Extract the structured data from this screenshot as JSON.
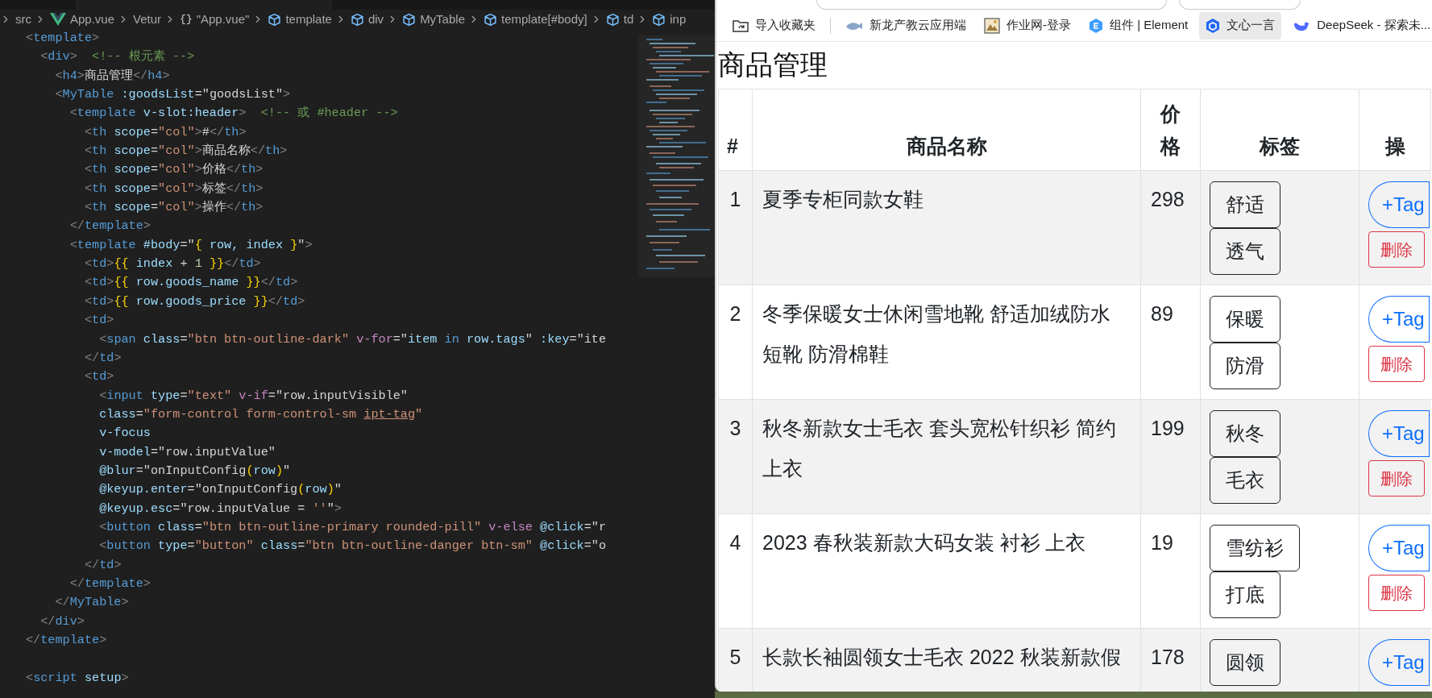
{
  "editor": {
    "breadcrumb": [
      {
        "kind": "folder",
        "text": "src"
      },
      {
        "kind": "vue",
        "text": "App.vue"
      },
      {
        "kind": "folder",
        "text": "Vetur"
      },
      {
        "kind": "module",
        "glyph": "{}",
        "text": "\"App.vue\""
      },
      {
        "kind": "element",
        "text": "template"
      },
      {
        "kind": "element",
        "text": "div"
      },
      {
        "kind": "element",
        "text": "MyTable"
      },
      {
        "kind": "element",
        "text": "template[#body]"
      },
      {
        "kind": "element",
        "text": "td"
      },
      {
        "kind": "element",
        "text": "inp"
      }
    ],
    "code": [
      {
        "tokens": [
          {
            "kind": "p",
            "text": "<"
          },
          {
            "kind": "tg",
            "text": "template"
          },
          {
            "kind": "p",
            "text": ">"
          }
        ]
      },
      {
        "tokens": [
          {
            "kind": "p",
            "text": "  <"
          },
          {
            "kind": "tg",
            "text": "div"
          },
          {
            "kind": "p",
            "text": ">"
          },
          {
            "kind": "c",
            "text": "  <!-- 根元素 -->"
          }
        ]
      },
      {
        "tokens": [
          {
            "kind": "p",
            "text": "    <"
          },
          {
            "kind": "tg",
            "text": "h4"
          },
          {
            "kind": "p",
            "text": ">"
          },
          {
            "kind": "t",
            "text": "商品管理"
          },
          {
            "kind": "p",
            "text": "</"
          },
          {
            "kind": "tg",
            "text": "h4"
          },
          {
            "kind": "p",
            "text": ">"
          }
        ]
      },
      {
        "tokens": [
          {
            "kind": "p",
            "text": "    <"
          },
          {
            "kind": "tg",
            "text": "MyTable"
          },
          {
            "kind": "at",
            "text": " :goodsList"
          },
          {
            "kind": "t",
            "text": "=\"goodsList\""
          },
          {
            "kind": "p",
            "text": ">"
          }
        ]
      },
      {
        "tokens": [
          {
            "kind": "p",
            "text": "      <"
          },
          {
            "kind": "tg",
            "text": "template"
          },
          {
            "kind": "at",
            "text": " v-slot:header"
          },
          {
            "kind": "p",
            "text": ">"
          },
          {
            "kind": "c",
            "text": "  <!-- 或 #header -->"
          }
        ]
      },
      {
        "tokens": [
          {
            "kind": "p",
            "text": "        <"
          },
          {
            "kind": "tg",
            "text": "th"
          },
          {
            "kind": "at",
            "text": " scope"
          },
          {
            "kind": "t",
            "text": "="
          },
          {
            "kind": "s",
            "text": "\"col\""
          },
          {
            "kind": "p",
            "text": ">"
          },
          {
            "kind": "t",
            "text": "#"
          },
          {
            "kind": "p",
            "text": "</"
          },
          {
            "kind": "tg",
            "text": "th"
          },
          {
            "kind": "p",
            "text": ">"
          }
        ]
      },
      {
        "tokens": [
          {
            "kind": "p",
            "text": "        <"
          },
          {
            "kind": "tg",
            "text": "th"
          },
          {
            "kind": "at",
            "text": " scope"
          },
          {
            "kind": "t",
            "text": "="
          },
          {
            "kind": "s",
            "text": "\"col\""
          },
          {
            "kind": "p",
            "text": ">"
          },
          {
            "kind": "t",
            "text": "商品名称"
          },
          {
            "kind": "p",
            "text": "</"
          },
          {
            "kind": "tg",
            "text": "th"
          },
          {
            "kind": "p",
            "text": ">"
          }
        ]
      },
      {
        "tokens": [
          {
            "kind": "p",
            "text": "        <"
          },
          {
            "kind": "tg",
            "text": "th"
          },
          {
            "kind": "at",
            "text": " scope"
          },
          {
            "kind": "t",
            "text": "="
          },
          {
            "kind": "s",
            "text": "\"col\""
          },
          {
            "kind": "p",
            "text": ">"
          },
          {
            "kind": "t",
            "text": "价格"
          },
          {
            "kind": "p",
            "text": "</"
          },
          {
            "kind": "tg",
            "text": "th"
          },
          {
            "kind": "p",
            "text": ">"
          }
        ]
      },
      {
        "tokens": [
          {
            "kind": "p",
            "text": "        <"
          },
          {
            "kind": "tg",
            "text": "th"
          },
          {
            "kind": "at",
            "text": " scope"
          },
          {
            "kind": "t",
            "text": "="
          },
          {
            "kind": "s",
            "text": "\"col\""
          },
          {
            "kind": "p",
            "text": ">"
          },
          {
            "kind": "t",
            "text": "标签"
          },
          {
            "kind": "p",
            "text": "</"
          },
          {
            "kind": "tg",
            "text": "th"
          },
          {
            "kind": "p",
            "text": ">"
          }
        ]
      },
      {
        "tokens": [
          {
            "kind": "p",
            "text": "        <"
          },
          {
            "kind": "tg",
            "text": "th"
          },
          {
            "kind": "at",
            "text": " scope"
          },
          {
            "kind": "t",
            "text": "="
          },
          {
            "kind": "s",
            "text": "\"col\""
          },
          {
            "kind": "p",
            "text": ">"
          },
          {
            "kind": "t",
            "text": "操作"
          },
          {
            "kind": "p",
            "text": "</"
          },
          {
            "kind": "tg",
            "text": "th"
          },
          {
            "kind": "p",
            "text": ">"
          }
        ]
      },
      {
        "tokens": [
          {
            "kind": "p",
            "text": "      </"
          },
          {
            "kind": "tg",
            "text": "template"
          },
          {
            "kind": "p",
            "text": ">"
          }
        ]
      },
      {
        "tokens": [
          {
            "kind": "p",
            "text": "      <"
          },
          {
            "kind": "tg",
            "text": "template"
          },
          {
            "kind": "at",
            "text": " #body"
          },
          {
            "kind": "t",
            "text": "=\""
          },
          {
            "kind": "y",
            "text": "{"
          },
          {
            "kind": "at",
            "text": " row, index "
          },
          {
            "kind": "y",
            "text": "}"
          },
          {
            "kind": "t",
            "text": "\""
          },
          {
            "kind": "p",
            "text": ">"
          }
        ]
      },
      {
        "tokens": [
          {
            "kind": "p",
            "text": "        <"
          },
          {
            "kind": "tg",
            "text": "td"
          },
          {
            "kind": "p",
            "text": ">"
          },
          {
            "kind": "y",
            "text": "{{"
          },
          {
            "kind": "at",
            "text": " index "
          },
          {
            "kind": "t",
            "text": "+ "
          },
          {
            "kind": "n",
            "text": "1"
          },
          {
            "kind": "y",
            "text": " }}"
          },
          {
            "kind": "p",
            "text": "</"
          },
          {
            "kind": "tg",
            "text": "td"
          },
          {
            "kind": "p",
            "text": ">"
          }
        ]
      },
      {
        "tokens": [
          {
            "kind": "p",
            "text": "        <"
          },
          {
            "kind": "tg",
            "text": "td"
          },
          {
            "kind": "p",
            "text": ">"
          },
          {
            "kind": "y",
            "text": "{{"
          },
          {
            "kind": "at",
            "text": " row.goods_name "
          },
          {
            "kind": "y",
            "text": "}}"
          },
          {
            "kind": "p",
            "text": "</"
          },
          {
            "kind": "tg",
            "text": "td"
          },
          {
            "kind": "p",
            "text": ">"
          }
        ]
      },
      {
        "tokens": [
          {
            "kind": "p",
            "text": "        <"
          },
          {
            "kind": "tg",
            "text": "td"
          },
          {
            "kind": "p",
            "text": ">"
          },
          {
            "kind": "y",
            "text": "{{"
          },
          {
            "kind": "at",
            "text": " row.goods_price "
          },
          {
            "kind": "y",
            "text": "}}"
          },
          {
            "kind": "p",
            "text": "</"
          },
          {
            "kind": "tg",
            "text": "td"
          },
          {
            "kind": "p",
            "text": ">"
          }
        ]
      },
      {
        "tokens": [
          {
            "kind": "p",
            "text": "        <"
          },
          {
            "kind": "tg",
            "text": "td"
          },
          {
            "kind": "p",
            "text": ">"
          }
        ]
      },
      {
        "tokens": [
          {
            "kind": "p",
            "text": "          <"
          },
          {
            "kind": "tg",
            "text": "span"
          },
          {
            "kind": "at",
            "text": " class"
          },
          {
            "kind": "t",
            "text": "="
          },
          {
            "kind": "s",
            "text": "\"btn btn-outline-dark\""
          },
          {
            "kind": "d",
            "text": " v-for"
          },
          {
            "kind": "t",
            "text": "=\""
          },
          {
            "kind": "at",
            "text": "item "
          },
          {
            "kind": "k",
            "text": "in"
          },
          {
            "kind": "at",
            "text": " row.tags"
          },
          {
            "kind": "t",
            "text": "\""
          },
          {
            "kind": "at",
            "text": " :key"
          },
          {
            "kind": "t",
            "text": "=\"ite"
          }
        ]
      },
      {
        "tokens": [
          {
            "kind": "p",
            "text": "        </"
          },
          {
            "kind": "tg",
            "text": "td"
          },
          {
            "kind": "p",
            "text": ">"
          }
        ]
      },
      {
        "tokens": [
          {
            "kind": "p",
            "text": "        <"
          },
          {
            "kind": "tg",
            "text": "td"
          },
          {
            "kind": "p",
            "text": ">"
          }
        ]
      },
      {
        "tokens": [
          {
            "kind": "p",
            "text": "          <"
          },
          {
            "kind": "tg",
            "text": "input"
          },
          {
            "kind": "at",
            "text": " type"
          },
          {
            "kind": "t",
            "text": "="
          },
          {
            "kind": "s",
            "text": "\"text\""
          },
          {
            "kind": "d",
            "text": " v-if"
          },
          {
            "kind": "t",
            "text": "=\"row.inputVisible\""
          }
        ]
      },
      {
        "tokens": [
          {
            "kind": "at",
            "text": "          class"
          },
          {
            "kind": "t",
            "text": "="
          },
          {
            "kind": "s",
            "text": "\"form-control form-control-sm "
          },
          {
            "kind": "su",
            "text": "ipt-tag"
          },
          {
            "kind": "s",
            "text": "\""
          }
        ]
      },
      {
        "tokens": [
          {
            "kind": "at",
            "text": "          v-focus"
          }
        ]
      },
      {
        "tokens": [
          {
            "kind": "at",
            "text": "          v-model"
          },
          {
            "kind": "t",
            "text": "=\"row.inputValue\""
          }
        ]
      },
      {
        "tokens": [
          {
            "kind": "at",
            "text": "          @blur"
          },
          {
            "kind": "t",
            "text": "=\"onInputConfig"
          },
          {
            "kind": "y",
            "text": "("
          },
          {
            "kind": "at",
            "text": "row"
          },
          {
            "kind": "y",
            "text": ")"
          },
          {
            "kind": "t",
            "text": "\""
          }
        ]
      },
      {
        "tokens": [
          {
            "kind": "at",
            "text": "          @keyup.enter"
          },
          {
            "kind": "t",
            "text": "=\"onInputConfig"
          },
          {
            "kind": "y",
            "text": "("
          },
          {
            "kind": "at",
            "text": "row"
          },
          {
            "kind": "y",
            "text": ")"
          },
          {
            "kind": "t",
            "text": "\""
          }
        ]
      },
      {
        "tokens": [
          {
            "kind": "at",
            "text": "          @keyup.esc"
          },
          {
            "kind": "t",
            "text": "=\"row.inputValue = "
          },
          {
            "kind": "s",
            "text": "''"
          },
          {
            "kind": "t",
            "text": "\""
          },
          {
            "kind": "p",
            "text": ">"
          }
        ]
      },
      {
        "tokens": [
          {
            "kind": "p",
            "text": "          <"
          },
          {
            "kind": "tg",
            "text": "button"
          },
          {
            "kind": "at",
            "text": " class"
          },
          {
            "kind": "t",
            "text": "="
          },
          {
            "kind": "s",
            "text": "\"btn btn-outline-primary rounded-pill\""
          },
          {
            "kind": "d",
            "text": " v-else"
          },
          {
            "kind": "at",
            "text": " @click"
          },
          {
            "kind": "t",
            "text": "=\"r"
          }
        ]
      },
      {
        "tokens": [
          {
            "kind": "p",
            "text": "          <"
          },
          {
            "kind": "tg",
            "text": "button"
          },
          {
            "kind": "at",
            "text": " type"
          },
          {
            "kind": "t",
            "text": "="
          },
          {
            "kind": "s",
            "text": "\"button\""
          },
          {
            "kind": "at",
            "text": " class"
          },
          {
            "kind": "t",
            "text": "="
          },
          {
            "kind": "s",
            "text": "\"btn btn-outline-danger btn-sm\""
          },
          {
            "kind": "at",
            "text": " @click"
          },
          {
            "kind": "t",
            "text": "=\"o"
          }
        ]
      },
      {
        "tokens": [
          {
            "kind": "p",
            "text": "        </"
          },
          {
            "kind": "tg",
            "text": "td"
          },
          {
            "kind": "p",
            "text": ">"
          }
        ]
      },
      {
        "tokens": [
          {
            "kind": "p",
            "text": "      </"
          },
          {
            "kind": "tg",
            "text": "template"
          },
          {
            "kind": "p",
            "text": ">"
          }
        ]
      },
      {
        "tokens": [
          {
            "kind": "p",
            "text": "    </"
          },
          {
            "kind": "tg",
            "text": "MyTable"
          },
          {
            "kind": "p",
            "text": ">"
          }
        ]
      },
      {
        "tokens": [
          {
            "kind": "p",
            "text": "  </"
          },
          {
            "kind": "tg",
            "text": "div"
          },
          {
            "kind": "p",
            "text": ">"
          }
        ]
      },
      {
        "tokens": [
          {
            "kind": "p",
            "text": "</"
          },
          {
            "kind": "tg",
            "text": "template"
          },
          {
            "kind": "p",
            "text": ">"
          }
        ]
      },
      {
        "gap_before": true,
        "tokens": [
          {
            "kind": "p",
            "text": "<"
          },
          {
            "kind": "tg",
            "text": "script"
          },
          {
            "kind": "at",
            "text": " setup"
          },
          {
            "kind": "p",
            "text": ">"
          }
        ]
      }
    ]
  },
  "browser": {
    "bookmarks": [
      {
        "kind": "folder",
        "text": "导入收藏夹",
        "hovered": false
      },
      {
        "kind": "cloud",
        "text": "新龙产教云应用端",
        "hovered": false
      },
      {
        "kind": "picture",
        "text": "作业网-登录",
        "hovered": false
      },
      {
        "kind": "hexagon",
        "text": "组件 | Element",
        "hovered": false
      },
      {
        "kind": "cube",
        "text": "文心一言",
        "hovered": true
      },
      {
        "kind": "whale",
        "text": "DeepSeek - 探索未...",
        "hovered": false
      }
    ],
    "heading": "商品管理",
    "table": {
      "columns": [
        "#",
        "商品名称",
        "价格",
        "标签",
        "操"
      ],
      "rows": [
        {
          "index": "1",
          "name": "夏季专柜同款女鞋",
          "price": "298",
          "tags": [
            "舒适",
            "透气"
          ],
          "actions": [
            {
              "kind": "add",
              "text": "+Tag"
            },
            {
              "kind": "delete",
              "text": "删除"
            }
          ]
        },
        {
          "index": "2",
          "name": "冬季保暖女士休闲雪地靴 舒适加绒防水短靴 防滑棉鞋",
          "price": "89",
          "tags": [
            "保暖",
            "防滑"
          ],
          "actions": [
            {
              "kind": "add",
              "text": "+Tag"
            },
            {
              "kind": "delete",
              "text": "删除"
            }
          ]
        },
        {
          "index": "3",
          "name": "秋冬新款女士毛衣 套头宽松针织衫 简约上衣",
          "price": "199",
          "tags": [
            "秋冬",
            "毛衣"
          ],
          "actions": [
            {
              "kind": "add",
              "text": "+Tag"
            },
            {
              "kind": "delete",
              "text": "删除"
            }
          ]
        },
        {
          "index": "4",
          "name": "2023 春秋装新款大码女装 衬衫 上衣",
          "price": "19",
          "tags": [
            "雪纺衫",
            "打底"
          ],
          "actions": [
            {
              "kind": "add",
              "text": "+Tag"
            },
            {
              "kind": "delete",
              "text": "删除"
            }
          ]
        },
        {
          "index": "5",
          "name": "长款长袖圆领女士毛衣 2022 秋装新款假",
          "price": "178",
          "tags": [
            "圆领"
          ],
          "actions": [
            {
              "kind": "add",
              "text": "+Tag"
            }
          ]
        }
      ]
    }
  }
}
